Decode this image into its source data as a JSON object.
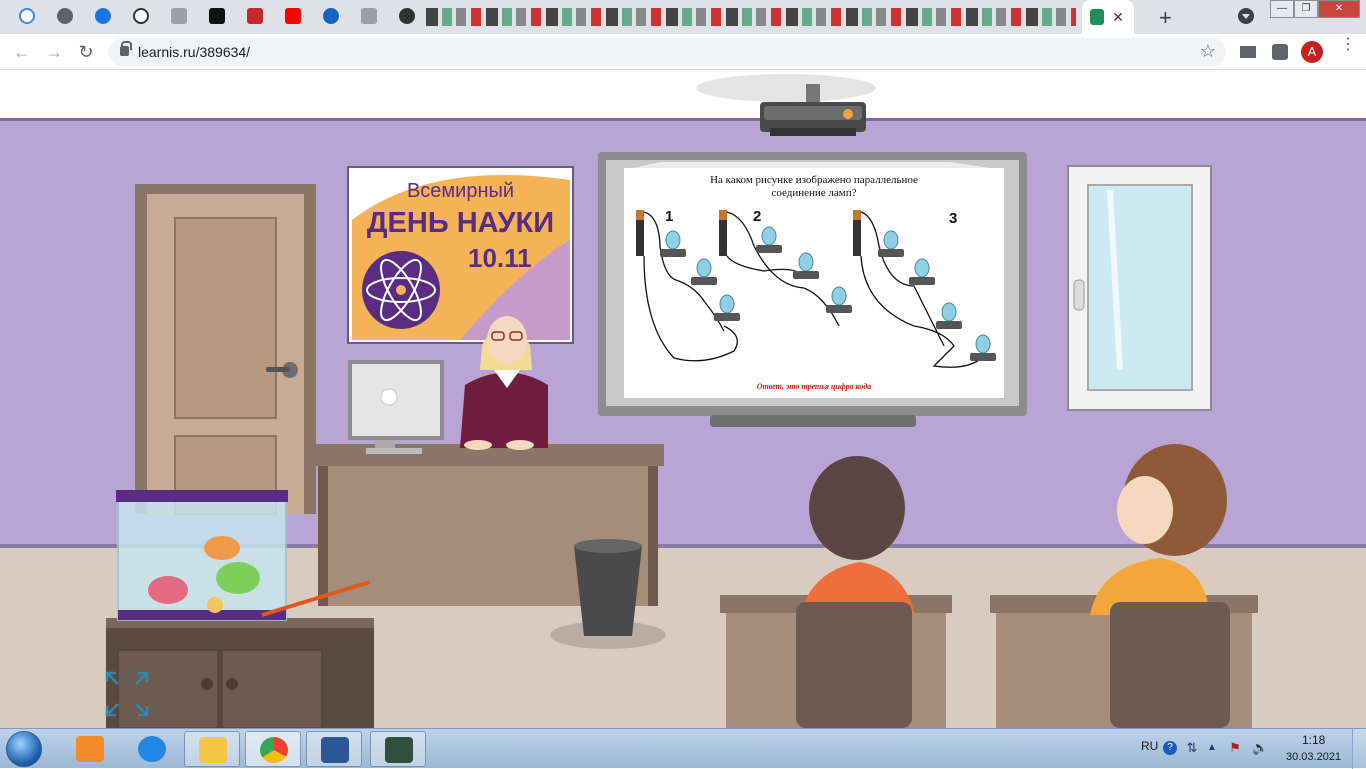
{
  "browser": {
    "tab_close": "✕",
    "new_tab": "+",
    "window_buttons": [
      "—",
      "❐",
      "✕"
    ],
    "address": "learnis.ru/389634/",
    "profile_initial": "A",
    "pinned_tab_icons": [
      "google-icon",
      "globe-icon",
      "browser-icon",
      "timer-icon",
      "gamepad-icon",
      "m-icon",
      "flag-icon",
      "youtube-icon",
      "app-icon",
      "gamepad-icon",
      "game-icon"
    ]
  },
  "scene": {
    "poster": {
      "line1": "Всемирный",
      "line2": "ДЕНЬ НАУКИ",
      "line3": "10.11"
    },
    "board": {
      "question_line1": "На каком рисунке изображено параллельное",
      "question_line2": "соединение ламп?",
      "fig1": "1",
      "fig2": "2",
      "fig3": "3",
      "answer_hint": "Ответ, это третья цифра кода"
    }
  },
  "taskbar": {
    "lang": "RU",
    "time": "1:18",
    "date": "30.03.2021",
    "apps": [
      "windows-media-player-icon",
      "internet-explorer-icon",
      "file-explorer-icon",
      "chrome-icon",
      "word-icon",
      "task-manager-icon"
    ]
  },
  "colors": {
    "wall": "#b8a5d6",
    "floor": "#d9cbc0",
    "accent_purple": "#5a2d82",
    "answer_red": "#d41a1a"
  }
}
